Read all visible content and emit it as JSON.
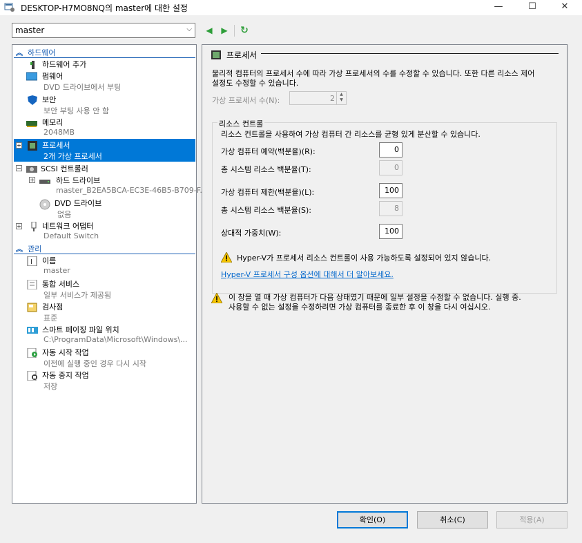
{
  "window": {
    "title": "DESKTOP-H7MO8NQ의 master에 대한 설정",
    "minimize": "—",
    "maximize": "☐",
    "close": "✕"
  },
  "vm_select": {
    "value": "master"
  },
  "toolbar": {
    "back": "◀",
    "forward": "▶",
    "refresh": "↻"
  },
  "hardware_section": {
    "label": "하드웨어"
  },
  "hardware_items": [
    {
      "name": "하드웨어 추가",
      "sub": ""
    },
    {
      "name": "펌웨어",
      "sub": "DVD 드라이브에서 부팅"
    },
    {
      "name": "보안",
      "sub": "보안 부팅 사용 안 함"
    },
    {
      "name": "메모리",
      "sub": "2048MB"
    },
    {
      "name": "프로세서",
      "sub": "2개 가상 프로세서"
    },
    {
      "name": "SCSI 컨트롤러",
      "sub": ""
    },
    {
      "name": "하드 드라이브",
      "sub": "master_B2EA5BCA-EC3E-46B5-B709-F..."
    },
    {
      "name": "DVD 드라이브",
      "sub": "없음"
    },
    {
      "name": "네트워크 어댑터",
      "sub": "Default Switch"
    }
  ],
  "management_section": {
    "label": "관리"
  },
  "management_items": [
    {
      "name": "이름",
      "sub": "master"
    },
    {
      "name": "통합 서비스",
      "sub": "일부 서비스가 제공됨"
    },
    {
      "name": "검사점",
      "sub": "표준"
    },
    {
      "name": "스마트 페이징 파일 위치",
      "sub": "C:\\ProgramData\\Microsoft\\Windows\\..."
    },
    {
      "name": "자동 시작 작업",
      "sub": "이전에 실행 중인 경우 다시 시작"
    },
    {
      "name": "자동 중지 작업",
      "sub": "저장"
    }
  ],
  "processor": {
    "title": "프로세서",
    "description_line1": "물리적 컴퓨터의 프로세서 수에 따라 가상 프로세서의 수를 수정할 수 있습니다. 또한 다른 리소스 제어",
    "description_line2": "설정도 수정할 수 있습니다.",
    "vcpu_label": "가상 프로세서 수(N):",
    "vcpu_value": "2",
    "resource_group_title": "리소스 컨트롤",
    "resource_desc": "리소스 컨트롤을 사용하여 가상 컴퓨터 간 리소스를 균형 있게 분산할 수 있습니다.",
    "reserve_label": "가상 컴퓨터 예약(백분율)(R):",
    "reserve_value": "0",
    "reserve_total_label": "총 시스템 리소스 백분율(T):",
    "reserve_total_value": "0",
    "limit_label": "가상 컴퓨터 제한(백분율)(L):",
    "limit_value": "100",
    "limit_total_label": "총 시스템 리소스 백분율(S):",
    "limit_total_value": "8",
    "weight_label": "상대적 가중치(W):",
    "weight_value": "100",
    "warning1": "Hyper-V가 프로세서 리소스 컨트롤이 사용 가능하도록 설정되어 있지 않습니다.",
    "link": "Hyper-V 프로세서 구성 옵션에 대해서 더 알아보세요.",
    "warning2_line1": "이 창을 열 때 가상 컴퓨터가 다음 상태였기 때문에 일부 설정을 수정할 수 없습니다. 실행 중.",
    "warning2_line2": "사용할 수 없는 설정을 수정하려면 가상 컴퓨터를 종료한 후 이 창을 다시 여십시오."
  },
  "buttons": {
    "ok": "확인(O)",
    "cancel": "취소(C)",
    "apply": "적용(A)"
  },
  "colors": {
    "selection": "#0078d7",
    "section_header": "#1a5fb4",
    "link": "#0066cc",
    "warning": "#f5c400"
  }
}
